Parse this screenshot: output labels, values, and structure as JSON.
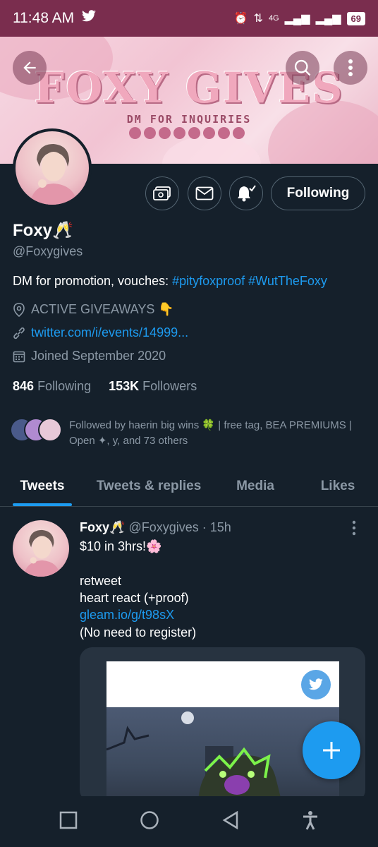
{
  "status_bar": {
    "time": "11:48 AM",
    "network": "4G",
    "battery": "69"
  },
  "banner": {
    "title": "FOXY GIVES",
    "subtitle": "DM FOR INQUIRIES"
  },
  "profile": {
    "name": "Foxy",
    "name_emoji": "🥂",
    "handle": "@Foxygives",
    "bio_text": "DM for promotion, vouches: ",
    "bio_tag1": "#pityfoxproof",
    "bio_tag2": "#WutTheFoxy",
    "location": "ACTIVE GIVEAWAYS 👇",
    "website": "twitter.com/i/events/14999...",
    "joined": "Joined September 2020",
    "following_count": "846",
    "following_label": "Following",
    "followers_count": "153K",
    "followers_label": "Followers",
    "followed_by": "Followed by haerin big wins 🍀 | free tag, BEA PREMIUMS | Open ✦, y, and 73 others",
    "following_button": "Following"
  },
  "tabs": [
    "Tweets",
    "Tweets & replies",
    "Media",
    "Likes"
  ],
  "tweet": {
    "name": "Foxy",
    "name_emoji": "🥂",
    "handle": "@Foxygives",
    "time": "· 15h",
    "line1": "$10 in 3hrs!🌸",
    "line2": "retweet",
    "line3": "heart react (+proof)",
    "link": "gleam.io/g/t98sX",
    "line4": "(No need to register)"
  },
  "colors": {
    "accent": "#1d9bf0",
    "background": "#15202b",
    "status_bar": "#7a2d4e"
  }
}
